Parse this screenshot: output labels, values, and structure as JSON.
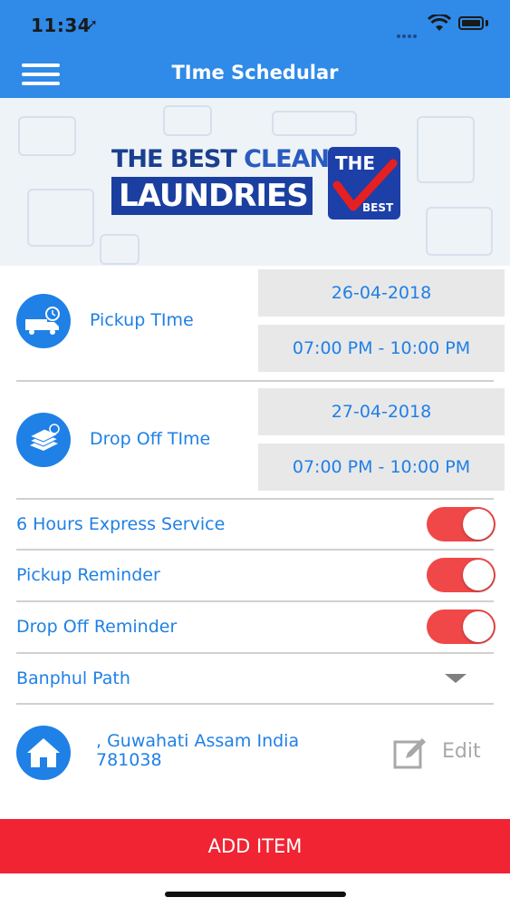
{
  "status_bar": {
    "time": "11:34",
    "location_arrow": "➚"
  },
  "header": {
    "title": "TIme Schedular",
    "menu_icon": "hamburger-icon"
  },
  "banner": {
    "line1_a": "THE BEST",
    "line1_b": "CLEANERS",
    "line2": "LAUNDRIES",
    "badge_top": "THE",
    "badge_bottom": "BEST"
  },
  "pickup": {
    "label": "Pickup TIme",
    "date": "26-04-2018",
    "slot": "07:00 PM - 10:00 PM"
  },
  "dropoff": {
    "label": "Drop Off TIme",
    "date": "27-04-2018",
    "slot": "07:00 PM - 10:00 PM"
  },
  "toggles": [
    {
      "label": "6 Hours Express Service",
      "on": true
    },
    {
      "label": "Pickup Reminder",
      "on": true
    },
    {
      "label": "Drop Off Reminder",
      "on": true
    }
  ],
  "location": {
    "selected": "Banphul Path"
  },
  "address": {
    "line1": ", Guwahati Assam India",
    "line2": "781038",
    "edit_label": "Edit"
  },
  "footer": {
    "add_item_label": "ADD ITEM"
  },
  "colors": {
    "primary": "#2f8ae8",
    "text_blue": "#1f80e6",
    "toggle_on": "#f04848",
    "add_button": "#f02432",
    "box_gray": "#e8e8e8"
  }
}
